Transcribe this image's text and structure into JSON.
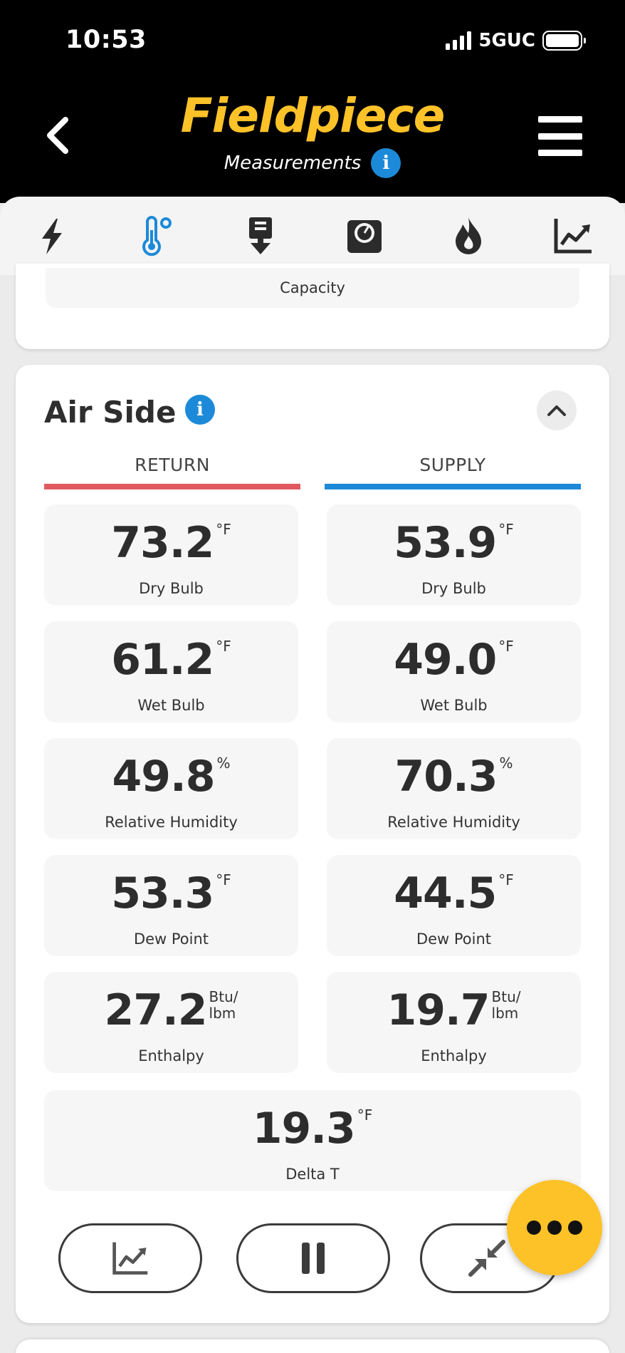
{
  "status_bar": {
    "time": "10:53",
    "network": "5GUC"
  },
  "header": {
    "logo": "Fieldpiece",
    "subtitle": "Measurements",
    "info_glyph": "i"
  },
  "tabs": [
    {
      "icon": "lightning-icon"
    },
    {
      "icon": "thermometer-icon",
      "active": true,
      "color": "#1c8ad8"
    },
    {
      "icon": "download-icon"
    },
    {
      "icon": "gauge-icon"
    },
    {
      "icon": "flame-icon"
    },
    {
      "icon": "chart-icon"
    }
  ],
  "capacity_label": "Capacity",
  "air_side": {
    "title": "Air Side",
    "return": {
      "header": "RETURN",
      "color": "#e05a60",
      "readings": [
        {
          "value": "73.2",
          "unit": "°F",
          "label": "Dry Bulb"
        },
        {
          "value": "61.2",
          "unit": "°F",
          "label": "Wet Bulb"
        },
        {
          "value": "49.8",
          "unit": "%",
          "label": "Relative Humidity"
        },
        {
          "value": "53.3",
          "unit": "°F",
          "label": "Dew Point"
        },
        {
          "value": "27.2",
          "unit_line1": "Btu/",
          "unit_line2": "lbm",
          "label": "Enthalpy"
        }
      ]
    },
    "supply": {
      "header": "SUPPLY",
      "color": "#1c8ad8",
      "readings": [
        {
          "value": "53.9",
          "unit": "°F",
          "label": "Dry Bulb"
        },
        {
          "value": "49.0",
          "unit": "°F",
          "label": "Wet Bulb"
        },
        {
          "value": "70.3",
          "unit": "%",
          "label": "Relative Humidity"
        },
        {
          "value": "44.5",
          "unit": "°F",
          "label": "Dew Point"
        },
        {
          "value": "19.7",
          "unit_line1": "Btu/",
          "unit_line2": "lbm",
          "label": "Enthalpy"
        }
      ]
    },
    "delta_t": {
      "value": "19.3",
      "unit": "°F",
      "label": "Delta T"
    }
  },
  "colors": {
    "accent": "#fdc228",
    "info": "#1c8ad8",
    "header_bg": "#000000"
  }
}
